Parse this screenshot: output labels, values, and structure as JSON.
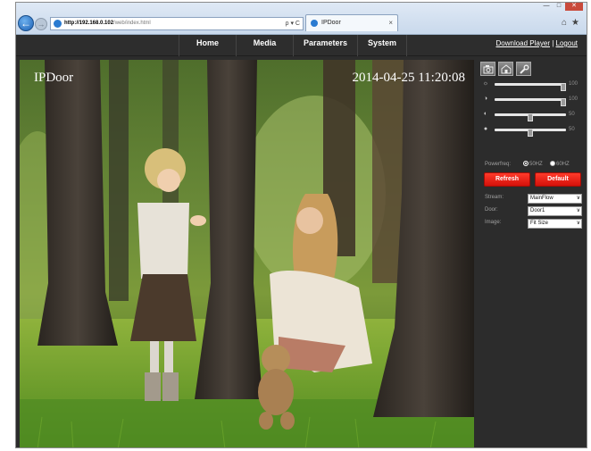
{
  "browser": {
    "url_bold": "http://192.168.0.102",
    "url_rest": "/web/index.html",
    "address_controls": "ρ ▾ C",
    "tab_title": "IPDoor",
    "tab_close": "×",
    "window_controls": [
      "—",
      "□",
      "✕"
    ],
    "back_glyph": "←",
    "forward_glyph": "→",
    "home_glyph": "⌂",
    "favorites_glyph": "★"
  },
  "nav": {
    "items": [
      "Home",
      "Media",
      "Parameters",
      "System"
    ],
    "download_player": "Download Player",
    "separator": "|",
    "logout": "Logout"
  },
  "video": {
    "osd_name": "IPDoor",
    "osd_timestamp": "2014-04-25 11:20:08"
  },
  "controls": {
    "tools": [
      "camera-snapshot-icon",
      "record-icon",
      "wrench-settings-icon"
    ],
    "sliders": [
      {
        "name": "brightness",
        "icon": "☼",
        "value": "100",
        "level": 1.0
      },
      {
        "name": "contrast",
        "icon": "◑",
        "value": "100",
        "level": 1.0
      },
      {
        "name": "saturation",
        "icon": "◐",
        "value": "50",
        "level": 0.5
      },
      {
        "name": "hue",
        "icon": "●",
        "value": "50",
        "level": 0.5
      }
    ],
    "powerfreq_label": "Powerfreq:",
    "powerfreq_options": [
      "50HZ",
      "60HZ"
    ],
    "powerfreq_selected": "50HZ",
    "refresh_label": "Refresh",
    "default_label": "Default",
    "stream_label": "Stream:",
    "stream_value": "MainFlow",
    "door_label": "Door:",
    "door_value": "Door1",
    "image_label": "Image:",
    "image_value": "Fit Size",
    "dropdown_glyph": "∨"
  },
  "colors": {
    "accent_red": "#e8170f",
    "panel_bg": "#2c2c2c",
    "chrome_blue": "#c9d9ec"
  }
}
